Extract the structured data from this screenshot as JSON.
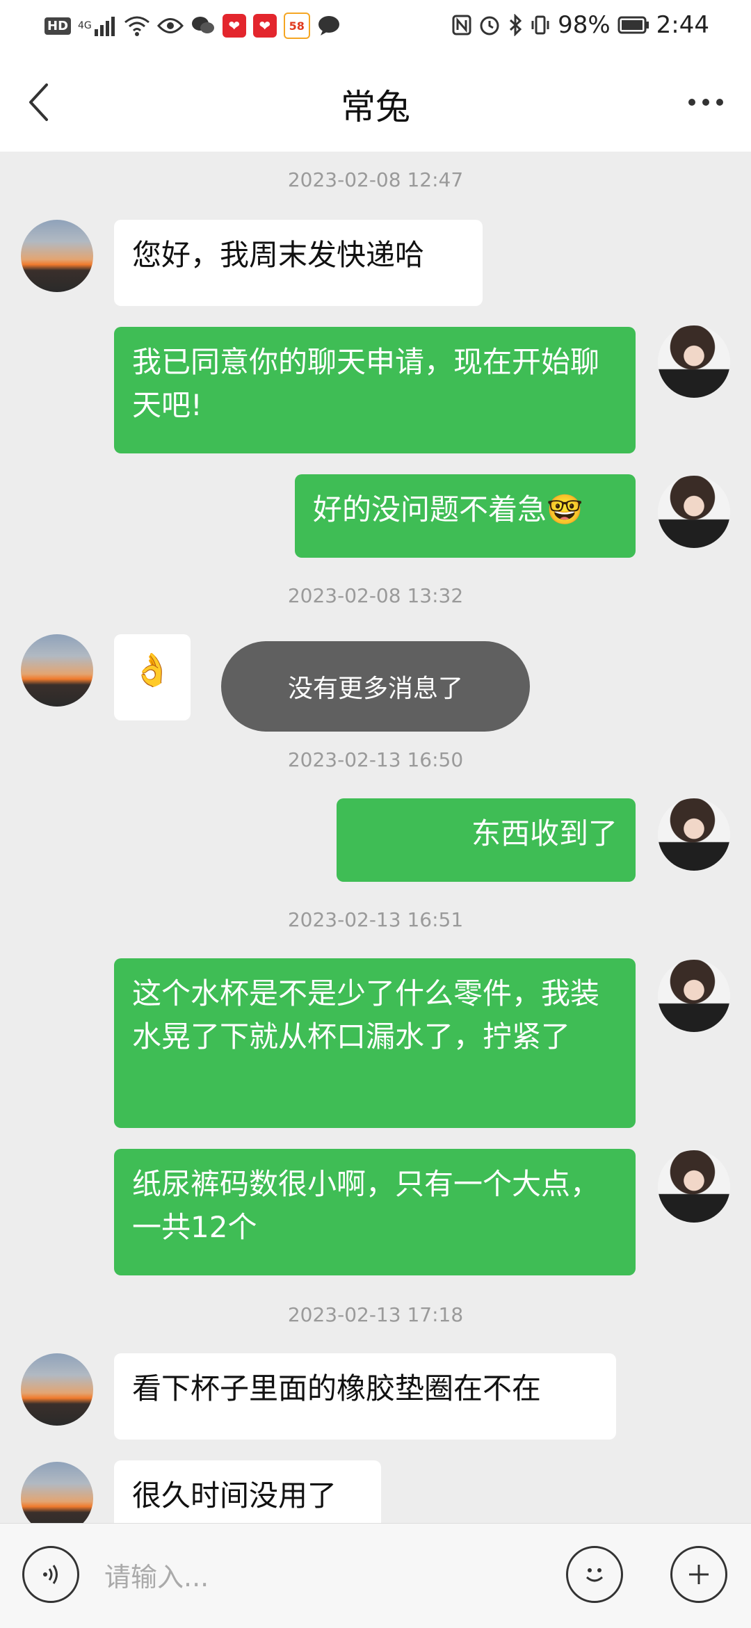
{
  "status_bar": {
    "network": "4G",
    "hd": "HD",
    "app58": "58",
    "battery": "98%",
    "time": "2:44"
  },
  "header": {
    "title": "常兔"
  },
  "messages": [
    {
      "type": "timestamp",
      "text": "2023-02-08 12:47"
    },
    {
      "type": "other",
      "text": "您好，我周末发快递哈"
    },
    {
      "type": "self",
      "text": "我已同意你的聊天申请，现在开始聊天吧!"
    },
    {
      "type": "self",
      "text": "好的没问题不着急🤓"
    },
    {
      "type": "timestamp",
      "text": "2023-02-08 13:32"
    },
    {
      "type": "other",
      "text": "👌"
    },
    {
      "type": "timestamp",
      "text": "2023-02-13 16:50"
    },
    {
      "type": "self",
      "text": "东西收到了"
    },
    {
      "type": "timestamp",
      "text": "2023-02-13 16:51"
    },
    {
      "type": "self",
      "text": "这个水杯是不是少了什么零件，我装水晃了下就从杯口漏水了，拧紧了"
    },
    {
      "type": "self",
      "text": "纸尿裤码数很小啊，只有一个大点，一共12个"
    },
    {
      "type": "timestamp",
      "text": "2023-02-13 17:18"
    },
    {
      "type": "other",
      "text": "看下杯子里面的橡胶垫圈在不在"
    },
    {
      "type": "other",
      "text": "很久时间没用了"
    }
  ],
  "toast": {
    "text": "没有更多消息了"
  },
  "input": {
    "placeholder": "请输入..."
  }
}
